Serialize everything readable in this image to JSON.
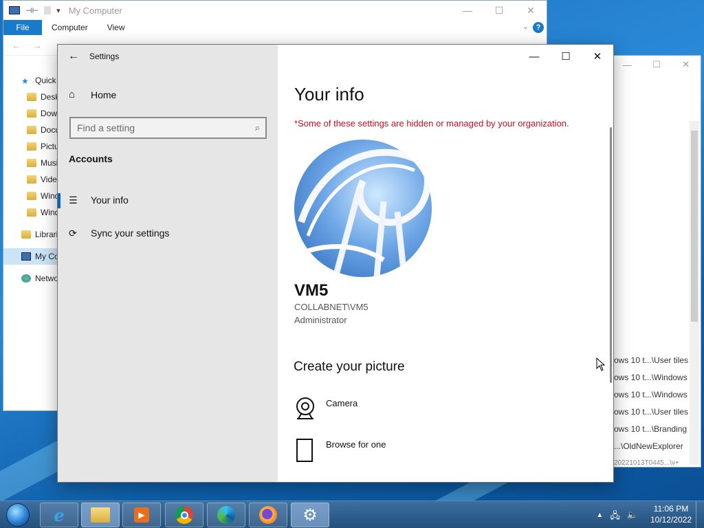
{
  "explorer": {
    "title": "My Computer",
    "ribbon_tabs": [
      "File",
      "Computer",
      "View"
    ],
    "help": "?",
    "nav_items": [
      {
        "label": "Quick",
        "icon": "star-icon"
      },
      {
        "label": "Deskt",
        "icon": "folder-icon"
      },
      {
        "label": "Dowr",
        "icon": "folder-icon"
      },
      {
        "label": "Docu",
        "icon": "folder-icon"
      },
      {
        "label": "Pictu",
        "icon": "folder-icon"
      },
      {
        "label": "Musi",
        "icon": "folder-icon"
      },
      {
        "label": "Video",
        "icon": "folder-icon"
      },
      {
        "label": "Windo",
        "icon": "folder-icon"
      },
      {
        "label": "Windo",
        "icon": "folder-icon"
      },
      {
        "label": "Librari",
        "icon": "library-icon"
      },
      {
        "label": "My Co",
        "icon": "computer-icon"
      },
      {
        "label": "Netwo",
        "icon": "network-icon"
      }
    ]
  },
  "explorer2": {
    "rows": [
      "ows 10 t...\\User tiles",
      "ows 10 t...\\Windows",
      "ows 10 t...\\Windows",
      "ows 10 t...\\User tiles",
      "ows 10 t...\\Branding",
      "...\\OldNewExplorer",
      "20221013T0445...\\v+"
    ]
  },
  "settings": {
    "window_title": "Settings",
    "home_label": "Home",
    "search_placeholder": "Find a setting",
    "section_label": "Accounts",
    "nav": [
      {
        "label": "Your info",
        "active": true
      },
      {
        "label": "Sync your settings",
        "active": false
      }
    ],
    "page_title": "Your info",
    "warning": "*Some of these settings are hidden or managed by your organization.",
    "user": {
      "name": "VM5",
      "domain": "COLLABNET\\VM5",
      "role": "Administrator"
    },
    "create_title": "Create your picture",
    "options": [
      {
        "label": "Camera",
        "icon": "camera-icon"
      },
      {
        "label": "Browse for one",
        "icon": "document-icon"
      }
    ]
  },
  "taskbar": {
    "apps": [
      "internet-explorer",
      "file-explorer",
      "media-player",
      "chrome",
      "edge",
      "firefox",
      "settings"
    ],
    "time": "11:06 PM",
    "date": "10/12/2022"
  }
}
